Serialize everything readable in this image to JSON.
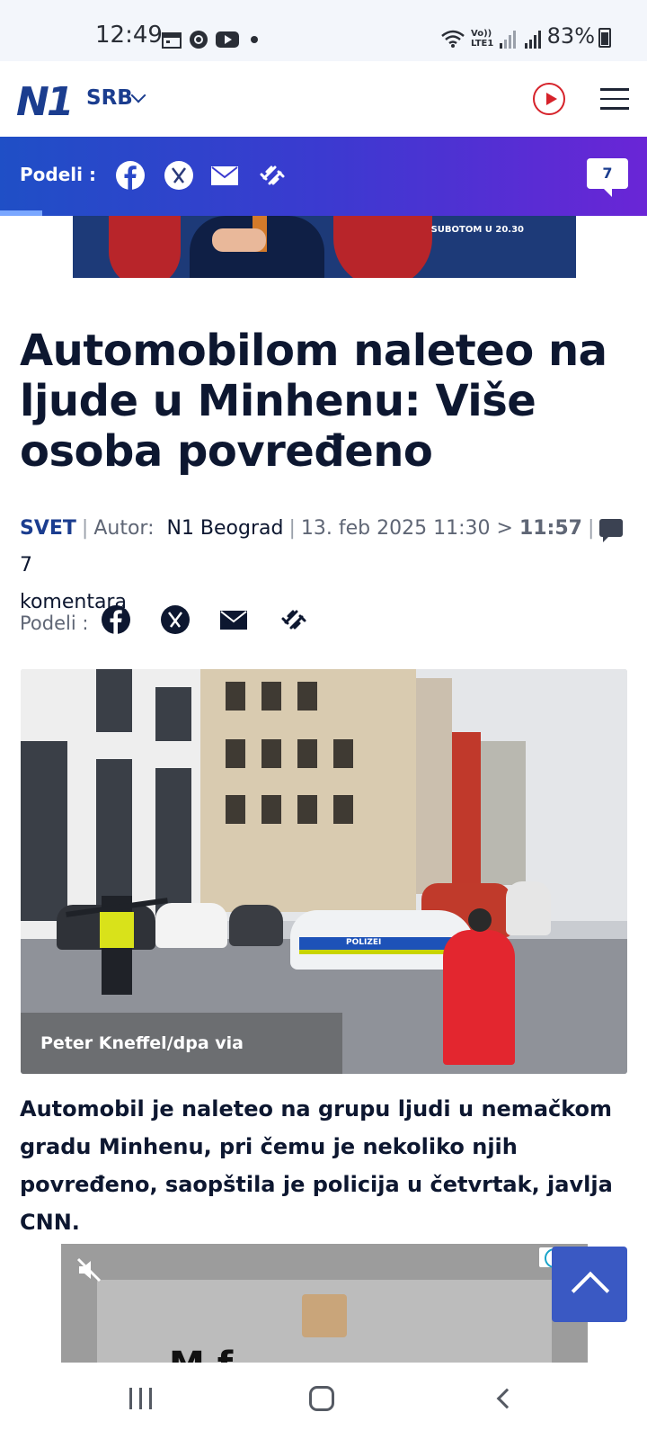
{
  "status_bar": {
    "time": "12:49",
    "right_text": "83%",
    "icons": [
      "calendar-icon",
      "chrome-icon",
      "youtube-icon",
      "dot-icon",
      "wifi-icon",
      "volte-icon",
      "signal-icon",
      "signal-icon",
      "battery-icon"
    ],
    "lte_label": "Vo)) LTE1"
  },
  "header": {
    "logo": "N1",
    "region": "SRB",
    "live_icon": "play-icon",
    "menu_icon": "hamburger-icon",
    "accent_color": "#1b3d8f",
    "live_color": "#d6222a"
  },
  "share_bar": {
    "label": "Podeli :",
    "icons": [
      "facebook-icon",
      "x-icon",
      "mail-icon",
      "link-icon"
    ],
    "comment_count": "7"
  },
  "ad_top": {
    "text": "SUBOTOM U 20.30"
  },
  "article": {
    "headline": "Automobilom naleteo na ljude u Minhenu: Više osoba povređeno",
    "category": "SVET",
    "author_label": "Autor:",
    "author": "N1 Beograd",
    "date": "13. feb 2025 11:30 >",
    "updated": "11:57",
    "comments_count": "7",
    "comments_label": "komentara",
    "share_label": "Podeli :",
    "photo_caption": "Peter Kneffel/dpa via AP/Tanjug",
    "photo_police_text": "POLIZEI",
    "lead": "Automobil je naleteo na grupu ljudi u nemačkom gradu Minhenu, pri čemu je nekoliko njih povređeno, saopštila je policija u četvrtak, javlja CNN."
  },
  "ad_bottom": {
    "partial_text": "M f"
  },
  "nav_bar": {
    "icons": [
      "recent-apps-icon",
      "home-icon",
      "back-icon"
    ]
  }
}
